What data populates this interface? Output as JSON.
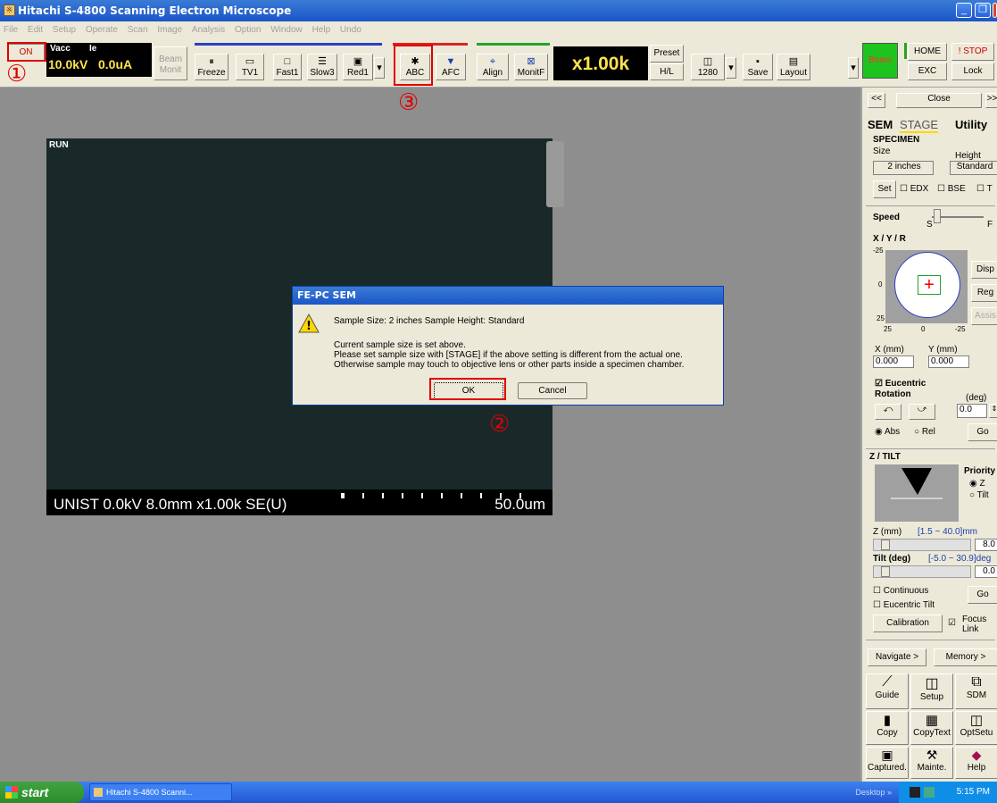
{
  "window": {
    "title": "Hitachi S-4800 Scanning Electron Microscope",
    "icon": "app-icon"
  },
  "menu": [
    "File",
    "Edit",
    "Setup",
    "Operate",
    "Scan",
    "Image",
    "Analysis",
    "Option",
    "Window",
    "Help",
    "Undo"
  ],
  "toolbar": {
    "on_label": "ON",
    "vacc_label": "Vacc",
    "ie_label": "Ie",
    "vacc_value": "10.0kV",
    "ie_value": "0.0uA",
    "beam_monit_1": "Beam",
    "beam_monit_2": "Monit",
    "freeze": "Freeze",
    "tv1": "TV1",
    "fast1": "Fast1",
    "slow3": "Slow3",
    "red1": "Red1",
    "abc": "ABC",
    "afc": "AFC",
    "align": "Align",
    "monitf": "MonitF",
    "magnification": "x1.00k",
    "preset": "Preset",
    "hl": "H/L",
    "res": "1280",
    "save": "Save",
    "layout": "Layout",
    "beam": "Beam",
    "home": "HOME",
    "stop": "! STOP",
    "exc": "EXC",
    "lock": "Lock"
  },
  "image": {
    "run": "RUN",
    "info": "UNIST 0.0kV 8.0mm x1.00k SE(U)",
    "scale": "50.0um"
  },
  "dialog": {
    "title": "FE-PC SEM",
    "line1": "Sample Size: 2 inches  Sample Height: Standard",
    "line2": "Current sample size is set above.",
    "line3": "Please set sample size with [STAGE] if the above setting is different from the actual one.",
    "line4": "Otherwise sample may touch to objective lens or other parts inside a specimen chamber.",
    "ok": "OK",
    "cancel": "Cancel"
  },
  "annotations": {
    "n1": "①",
    "n2": "②",
    "n3": "③"
  },
  "panel": {
    "nav_left": "<<",
    "close": "Close",
    "nav_right": ">>",
    "tab_sem": "SEM",
    "tab_stage": "STAGE",
    "tab_utility": "Utility",
    "specimen": "SPECIMEN",
    "size_label": "Size",
    "height_label": "Height",
    "size_value": "2 inches",
    "height_value": "Standard",
    "set": "Set",
    "edx": "EDX",
    "bse": "BSE",
    "t": "T",
    "speed": "Speed",
    "speed_s": "S",
    "speed_f": "F",
    "xyr": "X / Y / R",
    "tick_m25": "-25",
    "tick_0": "0",
    "tick_25": "25",
    "disp": "Disp",
    "reg": "Reg",
    "assis": "Assis",
    "x_label": "X (mm)",
    "y_label": "Y (mm)",
    "x_value": "0.000",
    "y_value": "0.000",
    "eucentric": "Eucentric",
    "rotation": "Rotation",
    "deg": "(deg)",
    "rot_value": "0.0",
    "abs": "Abs",
    "rel": "Rel",
    "go": "Go",
    "ztilt": "Z / TILT",
    "priority": "Priority",
    "prio_z": "Z",
    "prio_tilt": "Tilt",
    "z_label": "Z  (mm)",
    "z_range": "[1.5 ~ 40.0]mm",
    "z_value": "8.0",
    "tilt_label": "Tilt  (deg)",
    "tilt_range": "[-5.0 ~ 30.9]deg",
    "tilt_value": "0.0",
    "continuous": "Continuous",
    "eucentric_tilt": "Eucentric Tilt",
    "go2": "Go",
    "calibration": "Calibration",
    "focus": "Focus",
    "link": "Link",
    "navigate": "Navigate >",
    "memory": "Memory >",
    "guide": "Guide",
    "setup": "Setup",
    "sdm": "SDM",
    "copy": "Copy",
    "copytext": "CopyText",
    "optsetup": "OptSetu",
    "captured": "Captured.",
    "mainte": "Mainte.",
    "help": "Help"
  },
  "taskbar": {
    "start": "start",
    "task": "Hitachi S-4800 Scanni...",
    "desktop": "Desktop",
    "time": "5:15 PM"
  },
  "colors": {
    "title_blue": "#1b56c8",
    "annotation_red": "#e00000",
    "image_bg": "#19292a",
    "mag_bg": "#000000"
  }
}
